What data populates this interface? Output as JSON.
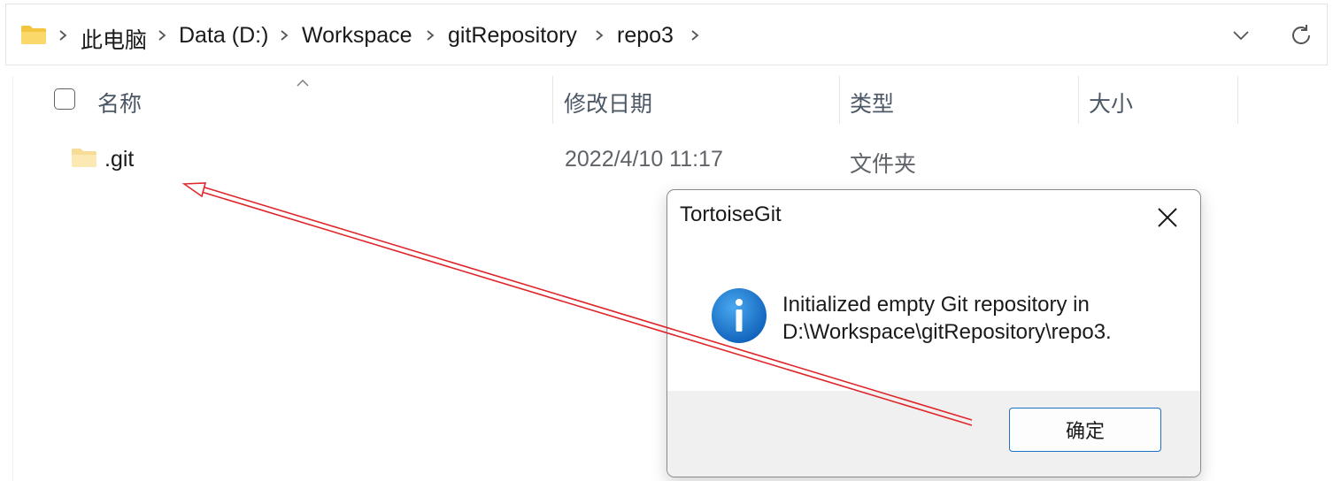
{
  "addressbar": {
    "folder_icon": "folder-icon",
    "crumbs": [
      "此电脑",
      "Data (D:)",
      "Workspace",
      "gitRepository",
      "repo3"
    ],
    "dropdown_icon": "chevron-down-icon",
    "refresh_icon": "refresh-icon"
  },
  "filelist": {
    "columns": {
      "name": "名称",
      "date": "修改日期",
      "type": "类型",
      "size": "大小"
    },
    "rows": [
      {
        "name": ".git",
        "date": "2022/4/10 11:17",
        "type": "文件夹",
        "size": ""
      }
    ]
  },
  "dialog": {
    "title": "TortoiseGit",
    "message_line1": "Initialized empty Git repository in",
    "message_line2": "D:\\Workspace\\gitRepository\\repo3.",
    "ok_label": "确定",
    "icon": "info-icon"
  },
  "colors": {
    "accent": "#1c72c6",
    "folder": "#f8d775",
    "annotation_arrow": "#e0262b",
    "info_icon": "#1a78d2"
  }
}
